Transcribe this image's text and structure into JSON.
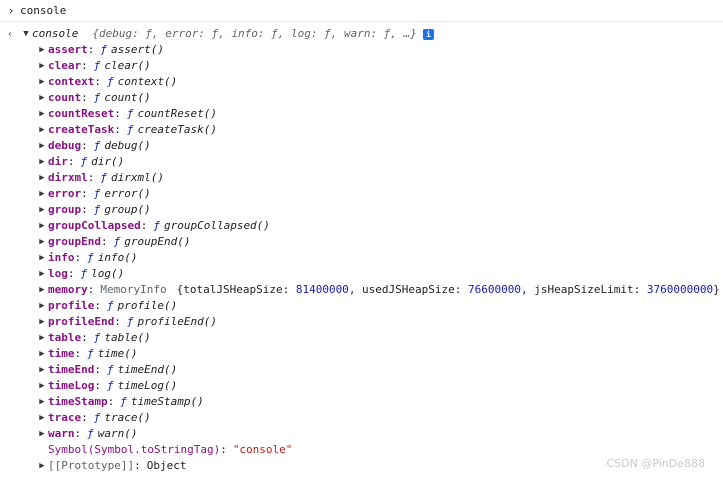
{
  "input": {
    "prompt_icon": "chevron-right-icon",
    "command": "console"
  },
  "result": {
    "arrow_icon": "chevron-left-icon",
    "object_name": "console",
    "preview": "{debug: ƒ, error: ƒ, info: ƒ, log: ƒ, warn: ƒ, …}",
    "info_badge": "i",
    "functions": [
      {
        "key": "assert",
        "fn": "ƒ",
        "name": "assert()"
      },
      {
        "key": "clear",
        "fn": "ƒ",
        "name": "clear()"
      },
      {
        "key": "context",
        "fn": "ƒ",
        "name": "context()"
      },
      {
        "key": "count",
        "fn": "ƒ",
        "name": "count()"
      },
      {
        "key": "countReset",
        "fn": "ƒ",
        "name": "countReset()"
      },
      {
        "key": "createTask",
        "fn": "ƒ",
        "name": "createTask()"
      },
      {
        "key": "debug",
        "fn": "ƒ",
        "name": "debug()"
      },
      {
        "key": "dir",
        "fn": "ƒ",
        "name": "dir()"
      },
      {
        "key": "dirxml",
        "fn": "ƒ",
        "name": "dirxml()"
      },
      {
        "key": "error",
        "fn": "ƒ",
        "name": "error()"
      },
      {
        "key": "group",
        "fn": "ƒ",
        "name": "group()"
      },
      {
        "key": "groupCollapsed",
        "fn": "ƒ",
        "name": "groupCollapsed()"
      },
      {
        "key": "groupEnd",
        "fn": "ƒ",
        "name": "groupEnd()"
      },
      {
        "key": "info",
        "fn": "ƒ",
        "name": "info()"
      },
      {
        "key": "log",
        "fn": "ƒ",
        "name": "log()"
      }
    ],
    "memory": {
      "key": "memory",
      "class_name": "MemoryInfo",
      "open": "{",
      "totalJSHeapSize_label": "totalJSHeapSize: ",
      "totalJSHeapSize": "81400000",
      "usedJSHeapSize_label": ", usedJSHeapSize: ",
      "usedJSHeapSize": "76600000",
      "jsHeapSizeLimit_label": ", jsHeapSizeLimit: ",
      "jsHeapSizeLimit": "3760000000",
      "close": "}"
    },
    "functions2": [
      {
        "key": "profile",
        "fn": "ƒ",
        "name": "profile()"
      },
      {
        "key": "profileEnd",
        "fn": "ƒ",
        "name": "profileEnd()"
      },
      {
        "key": "table",
        "fn": "ƒ",
        "name": "table()"
      },
      {
        "key": "time",
        "fn": "ƒ",
        "name": "time()"
      },
      {
        "key": "timeEnd",
        "fn": "ƒ",
        "name": "timeEnd()"
      },
      {
        "key": "timeLog",
        "fn": "ƒ",
        "name": "timeLog()"
      },
      {
        "key": "timeStamp",
        "fn": "ƒ",
        "name": "timeStamp()"
      },
      {
        "key": "trace",
        "fn": "ƒ",
        "name": "trace()"
      },
      {
        "key": "warn",
        "fn": "ƒ",
        "name": "warn()"
      }
    ],
    "symbol": {
      "key": "Symbol(Symbol.toStringTag)",
      "value": "\"console\""
    },
    "prototype": {
      "key": "[[Prototype]]",
      "value": "Object"
    }
  },
  "watermark": "CSDN @PinDe888"
}
